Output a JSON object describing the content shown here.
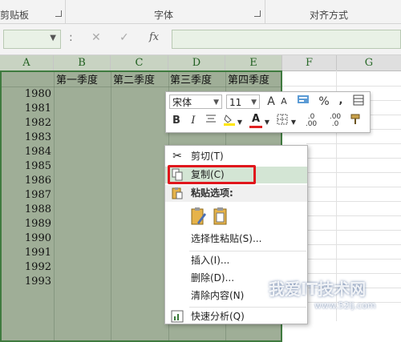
{
  "ribbon": {
    "groups": [
      {
        "label": "剪贴板"
      },
      {
        "label": "字体"
      },
      {
        "label": "对齐方式"
      }
    ]
  },
  "formula_bar": {
    "separator": ":",
    "cancel": "✕",
    "confirm": "✓",
    "fx": "fx"
  },
  "columns": [
    "A",
    "B",
    "C",
    "D",
    "E",
    "F",
    "G"
  ],
  "quarters": [
    "第一季度",
    "第二季度",
    "第三季度",
    "第四季度"
  ],
  "years": [
    "1980",
    "1981",
    "1982",
    "1983",
    "1984",
    "1985",
    "1986",
    "1987",
    "1988",
    "1989",
    "1990",
    "1991",
    "1992",
    "1993"
  ],
  "mini_toolbar": {
    "font": "宋体",
    "size": "11",
    "grow": "A",
    "shrink": "A",
    "percent": "%",
    "comma": ",",
    "bold": "B",
    "italic": "I",
    "font_color": "A",
    "dec_inc": ".00",
    "dec_dec": ".0"
  },
  "context_menu": {
    "cut": "剪切(T)",
    "copy": "复制(C)",
    "paste_options": "粘贴选项:",
    "paste_special": "选择性粘贴(S)...",
    "insert": "插入(I)...",
    "delete": "删除(D)...",
    "clear": "清除内容(N)",
    "quick_analysis": "快速分析(Q)"
  },
  "watermark": {
    "text": "我爱IT技术网",
    "url": "www.52ij.com"
  },
  "colors": {
    "selection": "#9fae97",
    "selection_border": "#3f7a3f",
    "highlight_box": "#e0161c"
  }
}
